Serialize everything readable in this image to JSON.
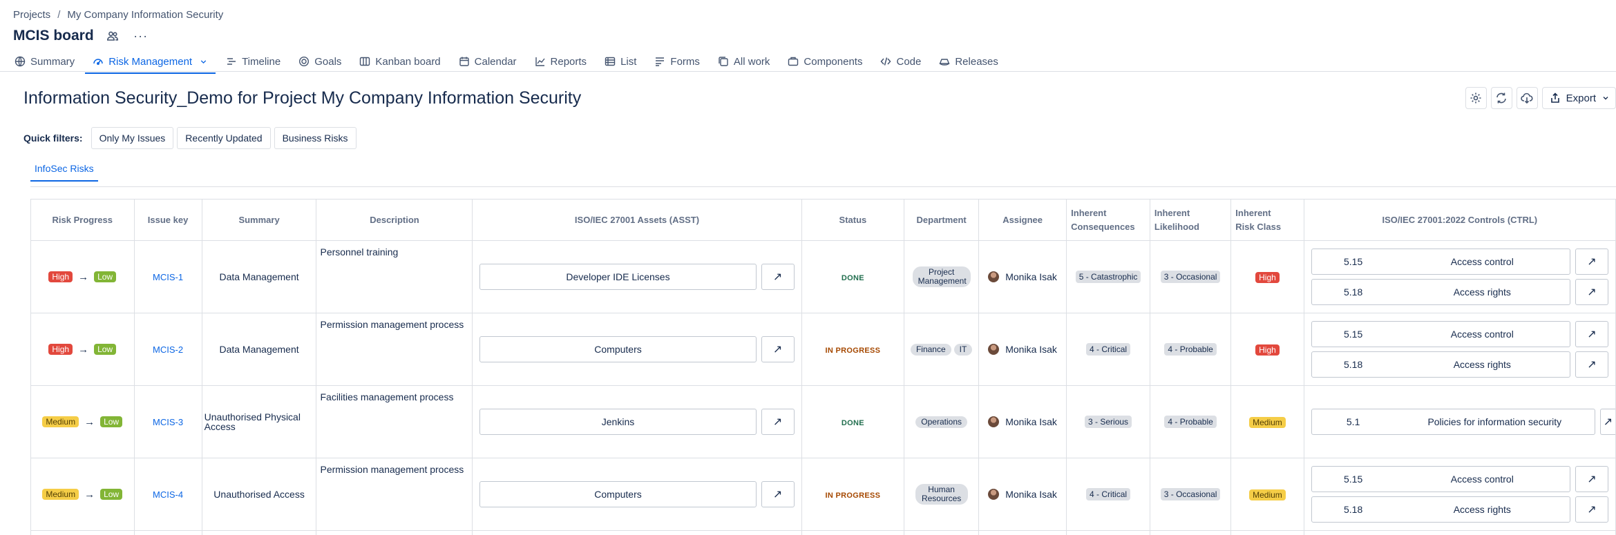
{
  "breadcrumb": {
    "projects": "Projects",
    "separator": "/",
    "project": "My Company Information Security"
  },
  "board_title": "MCIS board",
  "more_label": "···",
  "tabs": [
    {
      "label": "Summary",
      "icon": "globe-icon"
    },
    {
      "label": "Risk Management",
      "icon": "gauge-icon",
      "active": true
    },
    {
      "label": "Timeline",
      "icon": "timeline-icon"
    },
    {
      "label": "Goals",
      "icon": "target-icon"
    },
    {
      "label": "Kanban board",
      "icon": "board-icon"
    },
    {
      "label": "Calendar",
      "icon": "calendar-icon"
    },
    {
      "label": "Reports",
      "icon": "chart-icon"
    },
    {
      "label": "List",
      "icon": "list-icon"
    },
    {
      "label": "Forms",
      "icon": "forms-icon"
    },
    {
      "label": "All work",
      "icon": "stack-icon"
    },
    {
      "label": "Components",
      "icon": "component-icon"
    },
    {
      "label": "Code",
      "icon": "code-icon"
    },
    {
      "label": "Releases",
      "icon": "ship-icon"
    }
  ],
  "page_title": "Information Security_Demo for Project My Company Information Security",
  "actions": {
    "export_label": "Export"
  },
  "quick_filters": {
    "label": "Quick filters:",
    "items": [
      "Only My Issues",
      "Recently Updated",
      "Business Risks"
    ]
  },
  "sub_tab": "InfoSec Risks",
  "table": {
    "headers": {
      "risk_progress": "Risk Progress",
      "issue_key": "Issue key",
      "summary": "Summary",
      "description": "Description",
      "assets": "ISO/IEC 27001 Assets (ASST)",
      "status": "Status",
      "department": "Department",
      "assignee": "Assignee",
      "consequences_1": "Inherent",
      "consequences_2": "Consequences",
      "likelihood_1": "Inherent",
      "likelihood_2": "Likelihood",
      "risk_class_1": "Inherent",
      "risk_class_2": "Risk Class",
      "controls": "ISO/IEC 27001:2022 Controls (CTRL)"
    },
    "rows": [
      {
        "from": "High",
        "to": "Low",
        "key": "MCIS-1",
        "summary": "Data Management",
        "description": "Personnel training",
        "asset": "Developer IDE Licenses",
        "status": "DONE",
        "department": [
          "Project Management"
        ],
        "assignee": "Monika Isak",
        "consequences": "5 - Catastrophic",
        "likelihood": "3 - Occasional",
        "risk_class": "High",
        "controls": [
          {
            "num": "5.15",
            "name": "Access control"
          },
          {
            "num": "5.18",
            "name": "Access rights"
          }
        ]
      },
      {
        "from": "High",
        "to": "Low",
        "key": "MCIS-2",
        "summary": "Data Management",
        "description": "Permission management process",
        "asset": "Computers",
        "status": "IN PROGRESS",
        "department": [
          "Finance",
          "IT"
        ],
        "assignee": "Monika Isak",
        "consequences": "4 - Critical",
        "likelihood": "4 - Probable",
        "risk_class": "High",
        "controls": [
          {
            "num": "5.15",
            "name": "Access control"
          },
          {
            "num": "5.18",
            "name": "Access rights"
          }
        ]
      },
      {
        "from": "Medium",
        "to": "Low",
        "key": "MCIS-3",
        "summary": "Unauthorised Physical Access",
        "description": "Facilities management process",
        "asset": "Jenkins",
        "status": "DONE",
        "department": [
          "Operations"
        ],
        "assignee": "Monika Isak",
        "consequences": "3 - Serious",
        "likelihood": "4 - Probable",
        "risk_class": "Medium",
        "controls": [
          {
            "num": "5.1",
            "name": "Policies for information security"
          }
        ]
      },
      {
        "from": "Medium",
        "to": "Low",
        "key": "MCIS-4",
        "summary": "Unauthorised Access",
        "description": "Permission management process",
        "asset": "Computers",
        "status": "IN PROGRESS",
        "department": [
          "Human Resources"
        ],
        "assignee": "Monika Isak",
        "consequences": "4 - Critical",
        "likelihood": "3 - Occasional",
        "risk_class": "Medium",
        "controls": [
          {
            "num": "5.15",
            "name": "Access control"
          },
          {
            "num": "5.18",
            "name": "Access rights"
          }
        ]
      }
    ]
  },
  "colors": {
    "accent": "#0c66e4",
    "high": "#e2483d",
    "medium": "#f5cd47",
    "low": "#82b536",
    "done": "#216e4e",
    "in_progress": "#a54800"
  }
}
